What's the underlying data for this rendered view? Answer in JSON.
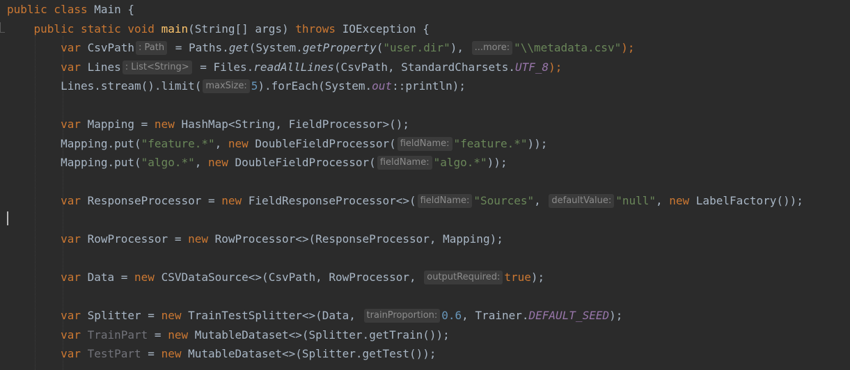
{
  "editor": {
    "code_lines": [
      {
        "segments": [
          {
            "t": "public class ",
            "c": "kw"
          },
          {
            "t": "Main {",
            "c": ""
          }
        ]
      },
      {
        "segments": [
          {
            "t": "    public static void ",
            "c": "kw"
          },
          {
            "t": "main",
            "c": "fn"
          },
          {
            "t": "(String[] args) ",
            "c": ""
          },
          {
            "t": "throws ",
            "c": "kw"
          },
          {
            "t": "IOException {",
            "c": ""
          }
        ]
      },
      {
        "segments": [
          {
            "t": "        var ",
            "c": "kw"
          },
          {
            "t": "CsvPath",
            "c": ""
          },
          {
            "t": ": Path",
            "c": "hint"
          },
          {
            "t": " = Paths.",
            "c": ""
          },
          {
            "t": "get",
            "c": "it"
          },
          {
            "t": "(System.",
            "c": ""
          },
          {
            "t": "getProperty",
            "c": "it"
          },
          {
            "t": "(",
            "c": ""
          },
          {
            "t": "\"user.dir\"",
            "c": "str"
          },
          {
            "t": "), ",
            "c": ""
          },
          {
            "t": "...more:",
            "c": "hint"
          },
          {
            "t": "\"\\\\metadata.csv\"",
            "c": "str"
          },
          {
            "t": ");",
            "c": "kw"
          }
        ]
      },
      {
        "segments": [
          {
            "t": "        var ",
            "c": "kw"
          },
          {
            "t": "Lines",
            "c": ""
          },
          {
            "t": ": List<String>",
            "c": "hint"
          },
          {
            "t": " = Files.",
            "c": ""
          },
          {
            "t": "readAllLines",
            "c": "it"
          },
          {
            "t": "(CsvPath, StandardCharsets.",
            "c": ""
          },
          {
            "t": "UTF_8",
            "c": "field"
          },
          {
            "t": ");",
            "c": "kw"
          }
        ]
      },
      {
        "segments": [
          {
            "t": "        Lines.stream().limit(",
            "c": ""
          },
          {
            "t": "maxSize:",
            "c": "hint"
          },
          {
            "t": "5",
            "c": "num"
          },
          {
            "t": ").forEach(System.",
            "c": ""
          },
          {
            "t": "out",
            "c": "field"
          },
          {
            "t": "::println);",
            "c": ""
          }
        ]
      },
      {
        "segments": []
      },
      {
        "segments": [
          {
            "t": "        var ",
            "c": "kw"
          },
          {
            "t": "Mapping = ",
            "c": ""
          },
          {
            "t": "new ",
            "c": "kw"
          },
          {
            "t": "HashMap<String, FieldProcessor>();",
            "c": ""
          }
        ]
      },
      {
        "segments": [
          {
            "t": "        Mapping.put(",
            "c": ""
          },
          {
            "t": "\"feature.*\"",
            "c": "str"
          },
          {
            "t": ", ",
            "c": ""
          },
          {
            "t": "new ",
            "c": "kw"
          },
          {
            "t": "DoubleFieldProcessor(",
            "c": ""
          },
          {
            "t": "fieldName:",
            "c": "hint"
          },
          {
            "t": "\"feature.*\"",
            "c": "str"
          },
          {
            "t": "));",
            "c": ""
          }
        ]
      },
      {
        "segments": [
          {
            "t": "        Mapping.put(",
            "c": ""
          },
          {
            "t": "\"algo.*\"",
            "c": "str"
          },
          {
            "t": ", ",
            "c": ""
          },
          {
            "t": "new ",
            "c": "kw"
          },
          {
            "t": "DoubleFieldProcessor(",
            "c": ""
          },
          {
            "t": "fieldName:",
            "c": "hint"
          },
          {
            "t": "\"algo.*\"",
            "c": "str"
          },
          {
            "t": "));",
            "c": ""
          }
        ]
      },
      {
        "segments": []
      },
      {
        "segments": [
          {
            "t": "        var ",
            "c": "kw"
          },
          {
            "t": "ResponseProcessor = ",
            "c": ""
          },
          {
            "t": "new ",
            "c": "kw"
          },
          {
            "t": "FieldResponseProcessor<>(",
            "c": ""
          },
          {
            "t": "fieldName:",
            "c": "hint"
          },
          {
            "t": "\"Sources\"",
            "c": "str"
          },
          {
            "t": ", ",
            "c": ""
          },
          {
            "t": "defaultValue:",
            "c": "hint"
          },
          {
            "t": "\"null\"",
            "c": "str"
          },
          {
            "t": ", ",
            "c": ""
          },
          {
            "t": "new ",
            "c": "kw"
          },
          {
            "t": "LabelFactory());",
            "c": ""
          }
        ]
      },
      {
        "segments": []
      },
      {
        "segments": [
          {
            "t": "        var ",
            "c": "kw"
          },
          {
            "t": "RowProcessor = ",
            "c": ""
          },
          {
            "t": "new ",
            "c": "kw"
          },
          {
            "t": "RowProcessor<>(ResponseProcessor, Mapping);",
            "c": ""
          }
        ]
      },
      {
        "segments": []
      },
      {
        "segments": [
          {
            "t": "        var ",
            "c": "kw"
          },
          {
            "t": "Data = ",
            "c": ""
          },
          {
            "t": "new ",
            "c": "kw"
          },
          {
            "t": "CSVDataSource<>(CsvPath, RowProcessor, ",
            "c": ""
          },
          {
            "t": "outputRequired:",
            "c": "hint"
          },
          {
            "t": "true",
            "c": "kw"
          },
          {
            "t": ");",
            "c": ""
          }
        ]
      },
      {
        "segments": []
      },
      {
        "segments": [
          {
            "t": "        var ",
            "c": "kw"
          },
          {
            "t": "Splitter = ",
            "c": ""
          },
          {
            "t": "new ",
            "c": "kw"
          },
          {
            "t": "TrainTestSplitter<>(Data, ",
            "c": ""
          },
          {
            "t": "trainProportion:",
            "c": "hint"
          },
          {
            "t": "0.6",
            "c": "num"
          },
          {
            "t": ", Trainer.",
            "c": ""
          },
          {
            "t": "DEFAULT_SEED",
            "c": "field"
          },
          {
            "t": ");",
            "c": ""
          }
        ]
      },
      {
        "segments": [
          {
            "t": "        var ",
            "c": "kw"
          },
          {
            "t": "TrainPart",
            "c": "unused"
          },
          {
            "t": " = ",
            "c": ""
          },
          {
            "t": "new ",
            "c": "kw"
          },
          {
            "t": "MutableDataset<>(Splitter.getTrain());",
            "c": ""
          }
        ]
      },
      {
        "segments": [
          {
            "t": "        var ",
            "c": "kw"
          },
          {
            "t": "TestPart",
            "c": "unused"
          },
          {
            "t": " = ",
            "c": ""
          },
          {
            "t": "new ",
            "c": "kw"
          },
          {
            "t": "MutableDataset<>(Splitter.getTest());",
            "c": ""
          }
        ]
      }
    ]
  },
  "colors": {
    "background": "#2b2b2b",
    "keyword": "#cc7832",
    "method_declaration": "#ffc66d",
    "string": "#6a8759",
    "number": "#6897bb",
    "static_field": "#9876aa",
    "default_text": "#a9b7c6",
    "unused_variable": "#72737a"
  }
}
